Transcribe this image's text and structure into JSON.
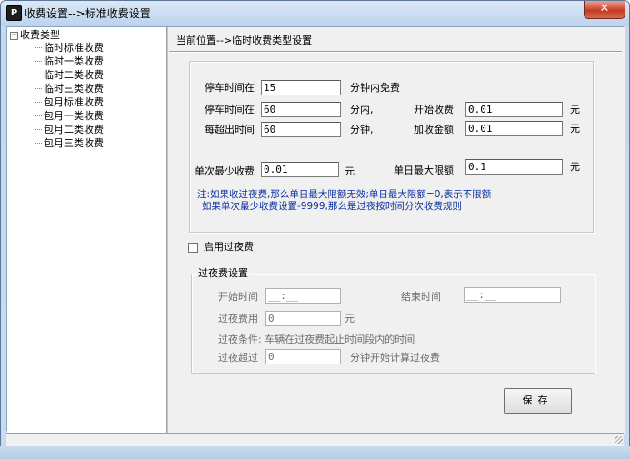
{
  "window": {
    "title": "收费设置-->标准收费设置",
    "icon_glyph": "P",
    "close_glyph": "✕"
  },
  "tree": {
    "expander": "−",
    "root": "收费类型",
    "items": [
      "临时标准收费",
      "临时一类收费",
      "临时二类收费",
      "临时三类收费",
      "包月标准收费",
      "包月一类收费",
      "包月二类收费",
      "包月三类收费"
    ]
  },
  "location": "当前位置-->临时收费类型设置",
  "fee": {
    "parking_within_label": "停车时间在",
    "parking_within_value": "15",
    "free_minutes_label": "分钟内免费",
    "parking_time_label": "停车时间在",
    "parking_time_value": "60",
    "minutes_within_label": "分内,",
    "start_fee_label": "开始收费",
    "start_fee_value": "0.01",
    "start_fee_unit": "元",
    "each_exceed_label": "每超出时间",
    "each_exceed_value": "60",
    "minutes_label": "分钟,",
    "add_fee_label": "加收金额",
    "add_fee_value": "0.01",
    "add_fee_unit": "元",
    "min_single_label": "单次最少收费",
    "min_single_value": "0.01",
    "min_single_unit": "元",
    "daily_max_label": "单日最大限额",
    "daily_max_value": "0.1",
    "daily_max_unit": "元",
    "note_line1": "注:如果收过夜费,那么单日最大限额无效;单日最大限额=0,表示不限额",
    "note_line2": "如果单次最少收费设置-9999,那么是过夜按时间分次收费规则"
  },
  "overnight": {
    "enable_label": "启用过夜费",
    "enabled": false,
    "group_title": "过夜费设置",
    "start_label": "开始时间",
    "start_value": "__:__",
    "end_label": "结束时间",
    "end_value": "__:__",
    "fee_label": "过夜费用",
    "fee_value": "0",
    "fee_unit": "元",
    "condition_text": "过夜条件: 车辆在过夜费起止时间段内的时间",
    "exceed_label": "过夜超过",
    "exceed_value": "0",
    "exceed_suffix": "分钟开始计算过夜费"
  },
  "buttons": {
    "save": "保存"
  }
}
